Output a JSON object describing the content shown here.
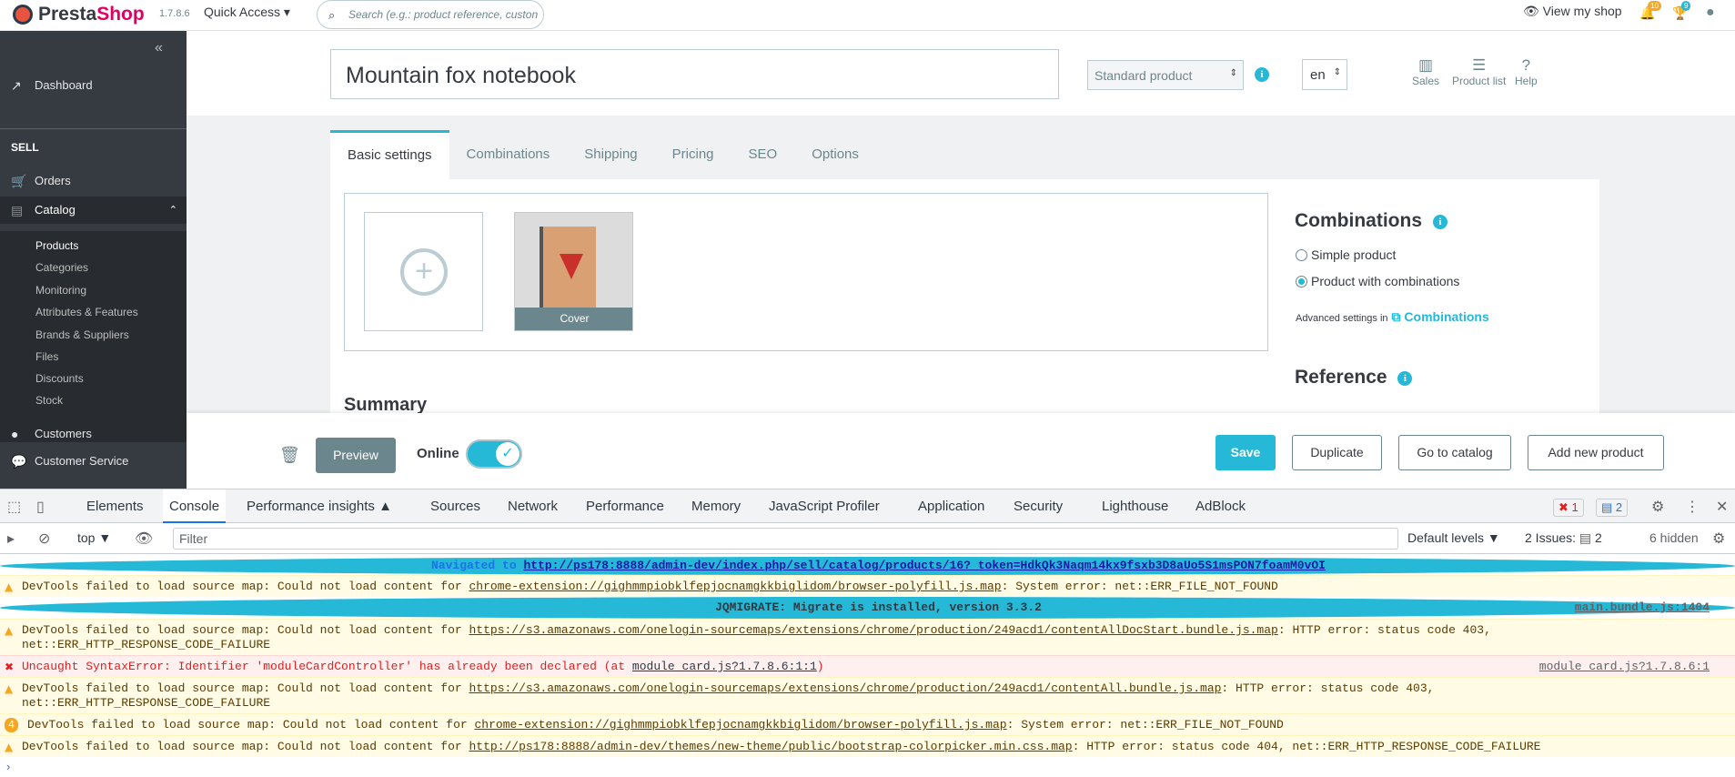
{
  "header": {
    "logo_text_a": "Presta",
    "logo_text_b": "Shop",
    "version": "1.7.8.6",
    "quick_access": "Quick Access ▾",
    "search_placeholder": "Search (e.g.: product reference, custon",
    "view_my_shop": "View my shop",
    "notif_orders": "10",
    "notif_customers": "9"
  },
  "sidebar": {
    "dashboard": "Dashboard",
    "section_sell": "SELL",
    "orders": "Orders",
    "catalog": "Catalog",
    "sub": [
      "Products",
      "Categories",
      "Monitoring",
      "Attributes & Features",
      "Brands & Suppliers",
      "Files",
      "Discounts",
      "Stock"
    ],
    "customers": "Customers",
    "customer_service": "Customer Service"
  },
  "product": {
    "name": "Mountain fox notebook",
    "type": "Standard product",
    "lang": "en",
    "tools": [
      "Sales",
      "Product list",
      "Help"
    ],
    "tabs": [
      "Basic settings",
      "Combinations",
      "Shipping",
      "Pricing",
      "SEO",
      "Options"
    ],
    "cover_label": "Cover",
    "summary_heading": "Summary",
    "combinations_heading": "Combinations",
    "radio_simple": "Simple product",
    "radio_combinations": "Product with combinations",
    "advanced_text": "Advanced settings in",
    "advanced_link": "Combinations",
    "reference_heading": "Reference"
  },
  "footer": {
    "preview": "Preview",
    "online": "Online",
    "save": "Save",
    "duplicate": "Duplicate",
    "go_to_catalog": "Go to catalog",
    "add_new_product": "Add new product"
  },
  "devtools": {
    "tabs": [
      "Elements",
      "Console",
      "Performance insights ▲",
      "Sources",
      "Network",
      "Performance",
      "Memory",
      "JavaScript Profiler",
      "Application",
      "Security",
      "Lighthouse",
      "AdBlock"
    ],
    "errors_count": "1",
    "messages_count": "2",
    "context": "top ▼",
    "filter_placeholder": "Filter",
    "default_levels": "Default levels ▼",
    "issues": "2 Issues:",
    "issues_count": "2",
    "hidden": "6 hidden",
    "logs": [
      {
        "prefix": "Navigated to ",
        "link": "http://ps178:8888/admin-dev/index.php/sell/catalog/products/16?_token=HdkQk3Naqm14kx9fsxb3D8aUo5S1msPON7foamM0vOI",
        "suffix": "",
        "src": ""
      },
      {
        "prefix": "DevTools failed to load source map: Could not load content for ",
        "link": "chrome-extension://gighmmpiobklfepjocnamgkkbiglidom/browser-polyfill.js.map",
        "suffix": ": System error: net::ERR_FILE_NOT_FOUND",
        "src": ""
      },
      {
        "prefix": "JQMIGRATE: Migrate is installed, version 3.3.2",
        "link": "",
        "suffix": "",
        "src": "main.bundle.js:1404"
      },
      {
        "prefix": "DevTools failed to load source map: Could not load content for ",
        "link": "https://s3.amazonaws.com/onelogin-sourcemaps/extensions/chrome/production/249acd1/contentAllDocStart.bundle.js.map",
        "suffix": ": HTTP error: status code 403,",
        "line2": "net::ERR_HTTP_RESPONSE_CODE_FAILURE",
        "src": ""
      },
      {
        "prefix": "Uncaught SyntaxError: Identifier 'moduleCardController' has already been declared (at ",
        "link": "module_card.js?1.7.8.6:1:1",
        "suffix": ")",
        "src": "module_card.js?1.7.8.6:1"
      },
      {
        "prefix": "DevTools failed to load source map: Could not load content for ",
        "link": "https://s3.amazonaws.com/onelogin-sourcemaps/extensions/chrome/production/249acd1/contentAll.bundle.js.map",
        "suffix": ": HTTP error: status code 403,",
        "line2": "net::ERR_HTTP_RESPONSE_CODE_FAILURE",
        "src": ""
      },
      {
        "prefix": "DevTools failed to load source map: Could not load content for ",
        "link": "chrome-extension://gighmmpiobklfepjocnamgkkbiglidom/browser-polyfill.js.map",
        "suffix": ": System error: net::ERR_FILE_NOT_FOUND",
        "src": "",
        "badge": "4"
      },
      {
        "prefix": "DevTools failed to load source map: Could not load content for ",
        "link": "http://ps178:8888/admin-dev/themes/new-theme/public/bootstrap-colorpicker.min.css.map",
        "suffix": ": HTTP error: status code 404, net::ERR_HTTP_RESPONSE_CODE_FAILURE",
        "src": ""
      }
    ]
  },
  "colors": {
    "accent": "#25b9d7",
    "sidebar": "#363a41",
    "brand_pink": "#df0067"
  }
}
